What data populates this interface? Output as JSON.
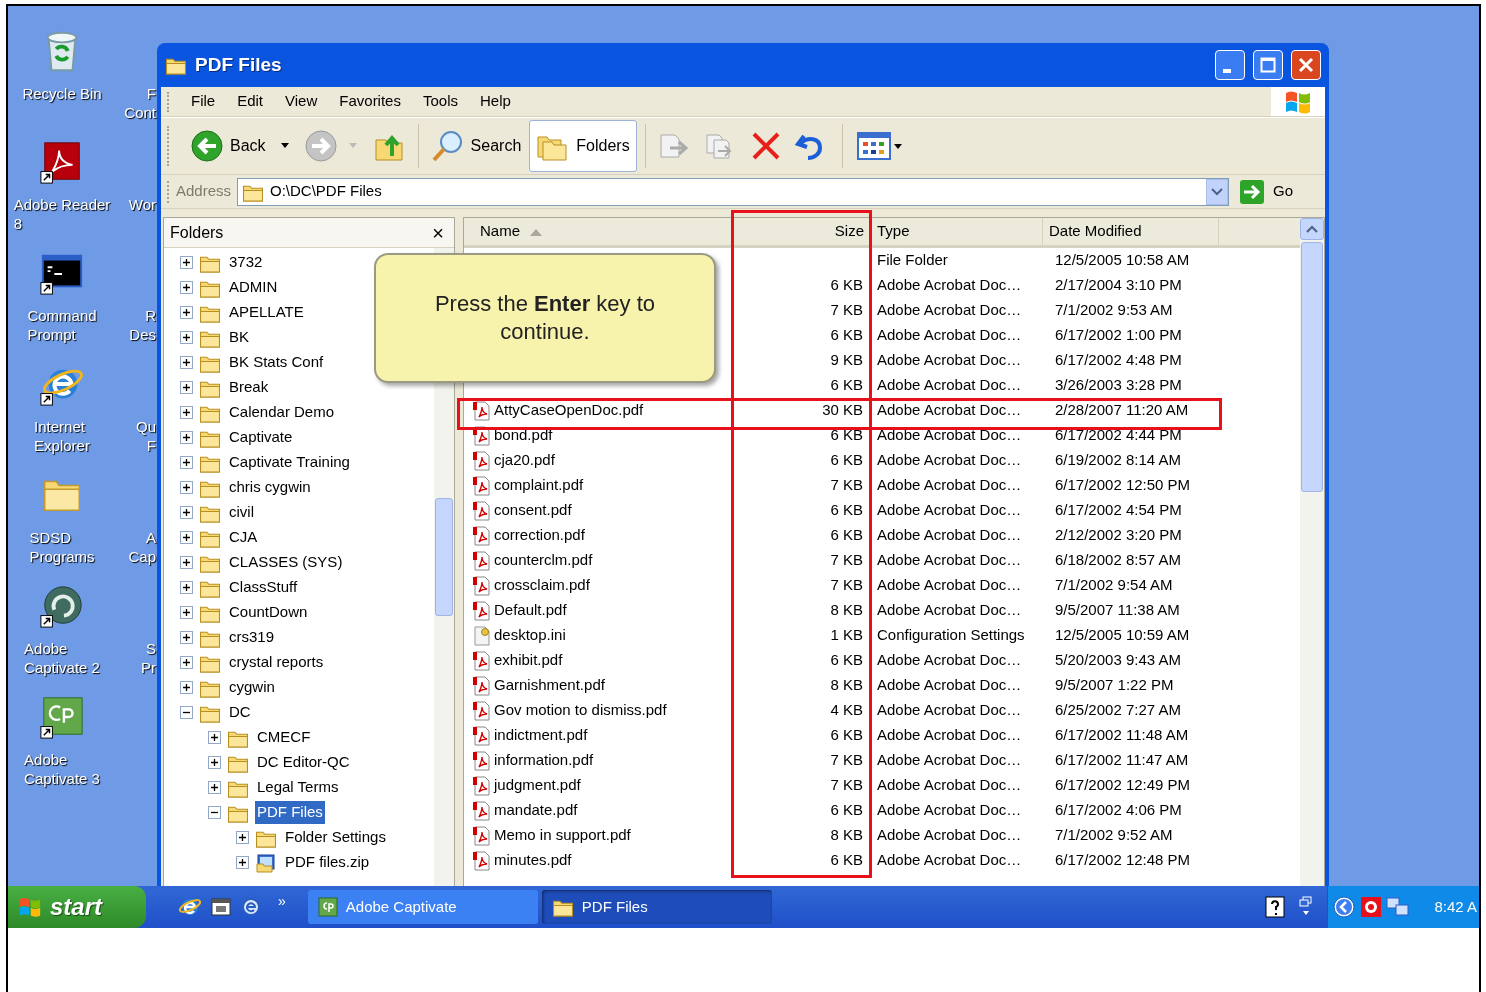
{
  "desktop_icons": [
    {
      "kind": "recycle",
      "lines": [
        "Recycle Bin"
      ]
    },
    {
      "kind": "reader",
      "lines": [
        "Adobe Reader",
        "8"
      ]
    },
    {
      "kind": "console",
      "lines": [
        "Command",
        "Prompt"
      ]
    },
    {
      "kind": "browser",
      "lines": [
        "Internet",
        "Explorer"
      ]
    },
    {
      "kind": "folder",
      "lines": [
        "SDSD",
        "Programs"
      ]
    },
    {
      "kind": "swirl",
      "lines": [
        "Adobe",
        "Captivate 2"
      ]
    },
    {
      "kind": "cp",
      "lines": [
        "Adobe",
        "Captivate 3"
      ]
    }
  ],
  "partial_icon_labels": [
    [
      "F",
      "Cont"
    ],
    [
      "Wor"
    ],
    [
      "R",
      "Des"
    ],
    [
      "Qu",
      "F"
    ],
    [
      "A",
      "Cap"
    ],
    [
      "S",
      "Pr"
    ]
  ],
  "window": {
    "title": "PDF Files"
  },
  "menu": [
    "File",
    "Edit",
    "View",
    "Favorites",
    "Tools",
    "Help"
  ],
  "toolbar": {
    "back": "Back",
    "search": "Search",
    "folders": {
      "label": "Folders",
      "selected": true
    }
  },
  "address": {
    "label": "Address",
    "value": "O:\\DC\\PDF Files",
    "go": "Go"
  },
  "folders_pane": {
    "title": "Folders",
    "close": "×",
    "tree": [
      {
        "label": "3732",
        "expanded": false,
        "selected": false
      },
      {
        "label": "ADMIN",
        "expanded": false,
        "selected": false
      },
      {
        "label": "APELLATE",
        "expanded": false,
        "selected": false
      },
      {
        "label": "BK",
        "expanded": false,
        "selected": false
      },
      {
        "label": "BK Stats Conf",
        "expanded": false,
        "selected": false
      },
      {
        "label": "Break",
        "expanded": false,
        "selected": false
      },
      {
        "label": "Calendar Demo",
        "expanded": false,
        "selected": false
      },
      {
        "label": "Captivate",
        "expanded": false,
        "selected": false
      },
      {
        "label": "Captivate Training",
        "expanded": false,
        "selected": false
      },
      {
        "label": "chris cygwin",
        "expanded": false,
        "selected": false
      },
      {
        "label": "civil",
        "expanded": false,
        "selected": false
      },
      {
        "label": "CJA",
        "expanded": false,
        "selected": false
      },
      {
        "label": "CLASSES (SYS)",
        "expanded": false,
        "selected": false
      },
      {
        "label": "ClassStuff",
        "expanded": false,
        "selected": false
      },
      {
        "label": "CountDown",
        "expanded": false,
        "selected": false
      },
      {
        "label": "crs319",
        "expanded": false,
        "selected": false
      },
      {
        "label": "crystal reports",
        "expanded": false,
        "selected": false
      },
      {
        "label": "cygwin",
        "expanded": false,
        "selected": false
      },
      {
        "label": "DC",
        "expanded": true,
        "selected": false,
        "children": [
          {
            "label": "CMECF",
            "expanded": false,
            "selected": false
          },
          {
            "label": "DC Editor-QC",
            "expanded": false,
            "selected": false
          },
          {
            "label": "Legal Terms",
            "expanded": false,
            "selected": false
          },
          {
            "label": "PDF Files",
            "expanded": true,
            "selected": true,
            "children": [
              {
                "label": "Folder Settings",
                "expanded": false,
                "selected": false
              },
              {
                "label": "PDF files.zip",
                "kind": "zip",
                "expanded": false,
                "selected": false
              }
            ]
          }
        ]
      }
    ]
  },
  "columns": [
    {
      "label": "Name",
      "sorted": true
    },
    {
      "label": "Size",
      "sorted": false
    },
    {
      "label": "Type",
      "sorted": false
    },
    {
      "label": "Date Modified",
      "sorted": false
    }
  ],
  "rows": [
    {
      "type": "File Folder",
      "date": "12/5/2005 10:58 AM"
    },
    {
      "size": "6 KB",
      "type": "Adobe Acrobat Doc…",
      "date": "2/17/2004 3:10 PM"
    },
    {
      "size": "7 KB",
      "type": "Adobe Acrobat Doc…",
      "date": "7/1/2002 9:53 AM"
    },
    {
      "size": "6 KB",
      "type": "Adobe Acrobat Doc…",
      "date": "6/17/2002 1:00 PM"
    },
    {
      "size": "9 KB",
      "type": "Adobe Acrobat Doc…",
      "date": "6/17/2002 4:48 PM"
    },
    {
      "size": "6 KB",
      "type": "Adobe Acrobat Doc…",
      "date": "3/26/2003 3:28 PM"
    },
    {
      "kind": "pdf",
      "name": "AttyCaseOpenDoc.pdf",
      "size": "30 KB",
      "type": "Adobe Acrobat Doc…",
      "date": "2/28/2007 11:20 AM"
    },
    {
      "kind": "pdf",
      "name": "bond.pdf",
      "size": "6 KB",
      "type": "Adobe Acrobat Doc…",
      "date": "6/17/2002 4:44 PM"
    },
    {
      "kind": "pdf",
      "name": "cja20.pdf",
      "size": "6 KB",
      "type": "Adobe Acrobat Doc…",
      "date": "6/19/2002 8:14 AM"
    },
    {
      "kind": "pdf",
      "name": "complaint.pdf",
      "size": "7 KB",
      "type": "Adobe Acrobat Doc…",
      "date": "6/17/2002 12:50 PM"
    },
    {
      "kind": "pdf",
      "name": "consent.pdf",
      "size": "6 KB",
      "type": "Adobe Acrobat Doc…",
      "date": "6/17/2002 4:54 PM"
    },
    {
      "kind": "pdf",
      "name": "correction.pdf",
      "size": "6 KB",
      "type": "Adobe Acrobat Doc…",
      "date": "2/12/2002 3:20 PM"
    },
    {
      "kind": "pdf",
      "name": "counterclm.pdf",
      "size": "7 KB",
      "type": "Adobe Acrobat Doc…",
      "date": "6/18/2002 8:57 AM"
    },
    {
      "kind": "pdf",
      "name": "crossclaim.pdf",
      "size": "7 KB",
      "type": "Adobe Acrobat Doc…",
      "date": "7/1/2002 9:54 AM"
    },
    {
      "kind": "pdf",
      "name": "Default.pdf",
      "size": "8 KB",
      "type": "Adobe Acrobat Doc…",
      "date": "9/5/2007 11:38 AM"
    },
    {
      "kind": "ini",
      "name": "desktop.ini",
      "size": "1 KB",
      "type": "Configuration Settings",
      "date": "12/5/2005 10:59 AM"
    },
    {
      "kind": "pdf",
      "name": "exhibit.pdf",
      "size": "6 KB",
      "type": "Adobe Acrobat Doc…",
      "date": "5/20/2003 9:43 AM"
    },
    {
      "kind": "pdf",
      "name": "Garnishment.pdf",
      "size": "8 KB",
      "type": "Adobe Acrobat Doc…",
      "date": "9/5/2007 1:22 PM"
    },
    {
      "kind": "pdf",
      "name": "Gov motion to dismiss.pdf",
      "size": "4 KB",
      "type": "Adobe Acrobat Doc…",
      "date": "6/25/2002 7:27 AM"
    },
    {
      "kind": "pdf",
      "name": "indictment.pdf",
      "size": "6 KB",
      "type": "Adobe Acrobat Doc…",
      "date": "6/17/2002 11:48 AM"
    },
    {
      "kind": "pdf",
      "name": "information.pdf",
      "size": "7 KB",
      "type": "Adobe Acrobat Doc…",
      "date": "6/17/2002 11:47 AM"
    },
    {
      "kind": "pdf",
      "name": "judgment.pdf",
      "size": "7 KB",
      "type": "Adobe Acrobat Doc…",
      "date": "6/17/2002 12:49 PM"
    },
    {
      "kind": "pdf",
      "name": "mandate.pdf",
      "size": "6 KB",
      "type": "Adobe Acrobat Doc…",
      "date": "6/17/2002 4:06 PM"
    },
    {
      "kind": "pdf",
      "name": "Memo in support.pdf",
      "size": "8 KB",
      "type": "Adobe Acrobat Doc…",
      "date": "7/1/2002 9:52 AM"
    },
    {
      "kind": "pdf",
      "name": "minutes.pdf",
      "size": "6 KB",
      "type": "Adobe Acrobat Doc…",
      "date": "6/17/2002 12:48 PM"
    }
  ],
  "callout": {
    "text": "Press the **Enter** key to continue."
  },
  "taskbar": {
    "start": "start",
    "overflow": "»",
    "tasks": [
      {
        "kind": "cp",
        "label": "Adobe Captivate",
        "selected": false
      },
      {
        "kind": "folder",
        "label": "PDF Files",
        "selected": true
      }
    ],
    "clock": "8:42 A"
  }
}
